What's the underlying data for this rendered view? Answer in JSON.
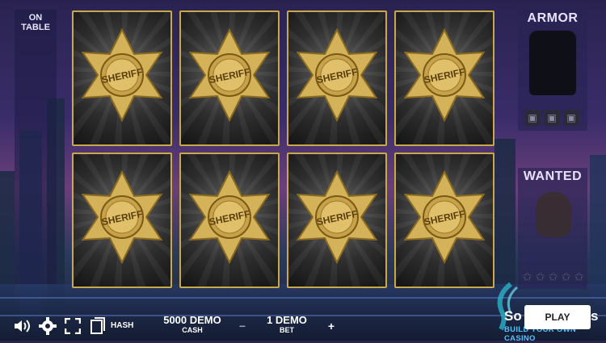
{
  "left_panel": {
    "title": "ON TABLE"
  },
  "armor_panel": {
    "title": "ARMOR",
    "slots": 3,
    "slot_icon": "vest-icon"
  },
  "wanted_panel": {
    "title": "WANTED",
    "stars_total": 5,
    "stars_filled": 0,
    "star_icon": "star-icon"
  },
  "cards": {
    "count": 8,
    "face": "sheriff-badge-icon",
    "badge_text": "SHERIFF"
  },
  "toolbar": {
    "sound_icon": "speaker-icon",
    "settings_icon": "gear-icon",
    "fullscreen_icon": "fullscreen-icon",
    "hash_icon": "document-icon",
    "hash_label": "HASH"
  },
  "cash": {
    "value": "5000 DEMO",
    "label": "CASH"
  },
  "bet": {
    "value": "1 DEMO",
    "label": "BET",
    "decrease": "−",
    "increase": "+"
  },
  "play_button": {
    "label": "PLAY"
  },
  "brand": {
    "name_prefix": "So",
    "name_suffix": "s",
    "tagline": "BUILD YOUR OWN CASINO"
  },
  "colors": {
    "card_border": "#c9a84a",
    "badge_gold": "#d4b25a",
    "brand_blue": "#4ec4ff"
  }
}
